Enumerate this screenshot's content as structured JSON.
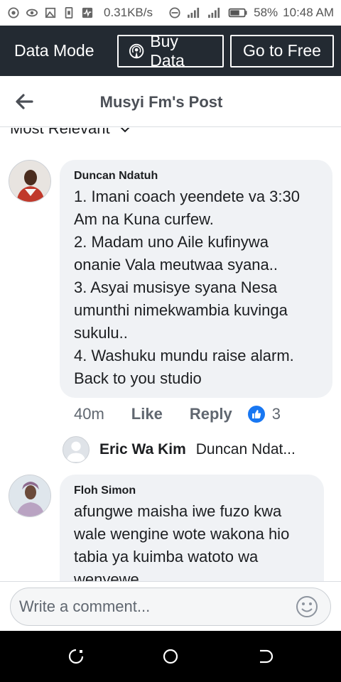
{
  "status_bar": {
    "speed": "0.31KB/s",
    "battery": "58%",
    "time": "10:48 AM"
  },
  "data_mode": {
    "label": "Data Mode",
    "buy_data": "Buy Data",
    "go_to_free": "Go to Free"
  },
  "header": {
    "title": "Musyi Fm's Post"
  },
  "sort": {
    "label": "Most Relevant"
  },
  "comments": [
    {
      "author": "Duncan Ndatuh",
      "lines": [
        "1. Imani coach yeendete va 3:30",
        "Am na Kuna curfew.",
        "2. Madam uno Aile kufinywa",
        "onanie Vala meutwaa syana..",
        "3. Asyai musisye syana Nesa",
        "umunthi nimekwambia kuvinga",
        "sukulu..",
        "4. Washuku mundu raise alarm.",
        "Back to you studio"
      ],
      "time": "40m",
      "like": "Like",
      "reply": "Reply",
      "reaction_count": "3",
      "reply_preview": {
        "name": "Eric Wa Kim",
        "snippet": "Duncan Ndat..."
      }
    },
    {
      "author": "Floh Simon",
      "lines": [
        "afungwe maisha iwe fuzo kwa",
        "wale wengine wote wakona hio",
        "tabia ya kuimba watoto wa",
        "wenyewe"
      ]
    }
  ],
  "composer": {
    "placeholder": "Write a comment..."
  },
  "colors": {
    "data_bar_bg": "#232a32",
    "bubble_bg": "#f0f2f5",
    "like_blue": "#1877f2"
  },
  "icons": [
    "back-arrow-icon",
    "chevron-down-icon",
    "podcast-icon",
    "like-thumb-icon",
    "smiley-icon",
    "recents-icon",
    "home-icon",
    "back-nav-icon"
  ]
}
